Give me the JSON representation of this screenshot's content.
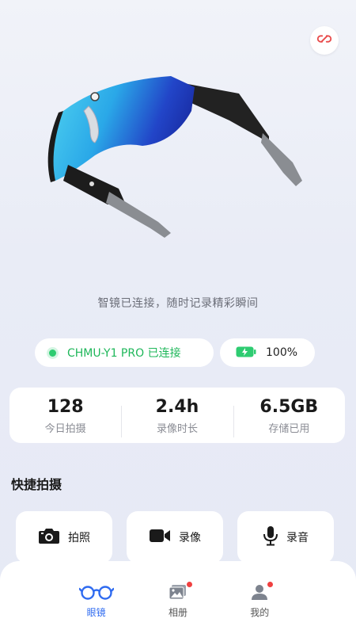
{
  "header": {
    "unlink_icon": "link-off-icon"
  },
  "hero": {
    "tagline": "智镜已连接，随时记录精彩瞬间"
  },
  "status": {
    "connection_label": "CHMU-Y1 PRO 已连接",
    "connection_color": "#1fb75a",
    "battery_label": "100%",
    "battery_level": 1.0,
    "battery_color": "#2ecc71"
  },
  "stats": [
    {
      "value": "128",
      "label": "今日拍摄"
    },
    {
      "value": "2.4h",
      "label": "录像时长"
    },
    {
      "value": "6.5GB",
      "label": "存储已用"
    }
  ],
  "quick": {
    "title": "快捷拍摄",
    "buttons": [
      {
        "label": "拍照",
        "icon": "camera-icon"
      },
      {
        "label": "录像",
        "icon": "video-camera-icon"
      },
      {
        "label": "录音",
        "icon": "microphone-icon"
      }
    ]
  },
  "tabs": [
    {
      "label": "眼镜",
      "icon": "glasses-icon",
      "active": true
    },
    {
      "label": "相册",
      "icon": "gallery-icon",
      "badge": true
    },
    {
      "label": "我的",
      "icon": "profile-icon",
      "badge": true
    }
  ],
  "colors": {
    "accent": "#2f6bf0",
    "badge": "#f04040",
    "lens": "#1fa0e8"
  }
}
